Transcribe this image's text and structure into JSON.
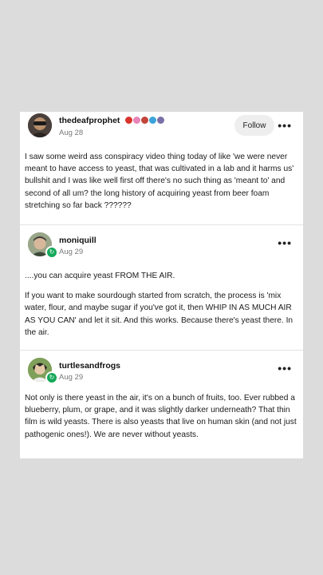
{
  "posts": [
    {
      "username": "thedeafprophet",
      "date": "Aug 28",
      "follow_label": "Follow",
      "more_label": "•••",
      "paragraphs": [
        "I saw some weird ass conspiracy video thing today of like 'we were never meant to have access to yeast, that was cultivated in a lab and it harms us' bullshit and I was like well first off there's no such thing as 'meant to' and second of all um? the long history of acquiring yeast from beer foam stretching so far back ??????"
      ]
    },
    {
      "username": "moniquill",
      "date": "Aug 29",
      "more_label": "•••",
      "paragraphs": [
        "....you can acquire yeast FROM THE AIR.",
        "If you want to make sourdough started from scratch, the process is 'mix water, flour, and maybe sugar if you've got it, then WHIP IN AS MUCH AIR AS YOU CAN' and let it sit. And this works. Because there's yeast there. In the air."
      ]
    },
    {
      "username": "turtlesandfrogs",
      "date": "Aug 29",
      "more_label": "•••",
      "paragraphs": [
        "Not only is there yeast in the air, it's on a bunch of fruits, too. Ever rubbed a blueberry, plum, or grape,  and it was slightly darker underneath? That thin film is wild yeasts. There is also yeasts that live on human skin (and not just pathogenic ones!). We are never without yeasts."
      ]
    }
  ],
  "colors": {
    "background": "#dcdcdc",
    "card": "#ffffff",
    "reblog_badge": "#15a85a"
  }
}
